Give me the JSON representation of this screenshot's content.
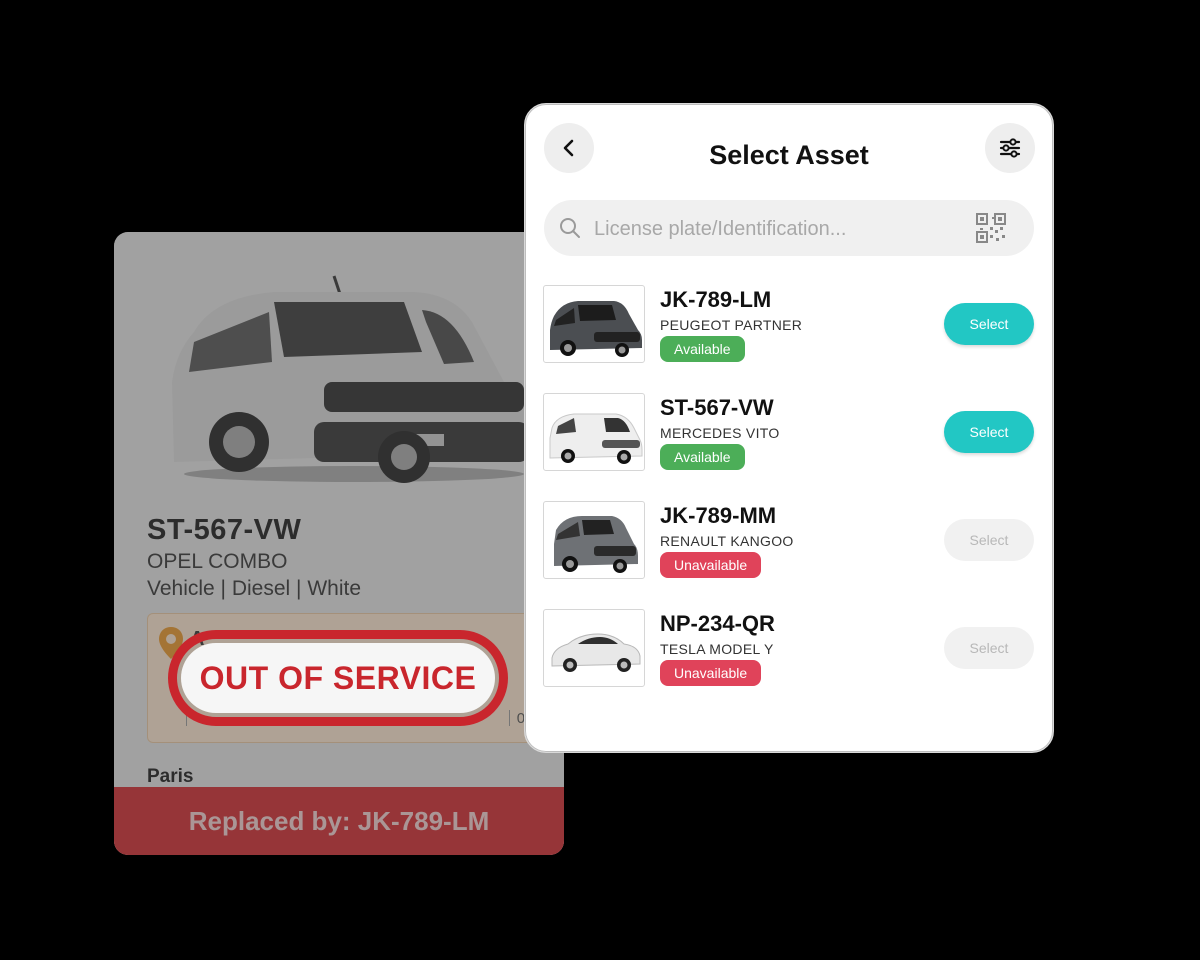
{
  "back_card": {
    "plate": "ST-567-VW",
    "model": "OPEL COMBO",
    "specs": "Vehicle | Diesel | White",
    "location_letter": "A",
    "time": "08:3",
    "stamp": "OUT OF SERVICE",
    "city": "Paris",
    "replaced_by": "Replaced by: JK-789-LM",
    "colors": {
      "stamp": "#c9262d",
      "replaced_bar": "#d12a2f",
      "location_box": "#fbe6cf"
    }
  },
  "panel": {
    "title": "Select Asset",
    "back_icon": "chevron-left-icon",
    "filter_icon": "sliders-icon",
    "search": {
      "placeholder": "License plate/Identification...",
      "value": ""
    },
    "assets": [
      {
        "plate": "JK-789-LM",
        "model": "PEUGEOT PARTNER",
        "status": "Available",
        "button": "Select",
        "enabled": true,
        "thumb_icon": "van-photo"
      },
      {
        "plate": "ST-567-VW",
        "model": "MERCEDES VITO",
        "status": "Available",
        "button": "Select",
        "enabled": true,
        "thumb_icon": "van-photo"
      },
      {
        "plate": "JK-789-MM",
        "model": "RENAULT KANGOO",
        "status": "Unavailable",
        "button": "Select",
        "enabled": false,
        "thumb_icon": "van-photo"
      },
      {
        "plate": "NP-234-QR",
        "model": "TESLA MODEL Y",
        "status": "Unavailable",
        "button": "Select",
        "enabled": false,
        "thumb_icon": "car-photo"
      }
    ],
    "colors": {
      "available": "#4cae58",
      "unavailable": "#e0435a",
      "select_enabled": "#22c7c4",
      "select_disabled": "#f1f1f1"
    }
  }
}
